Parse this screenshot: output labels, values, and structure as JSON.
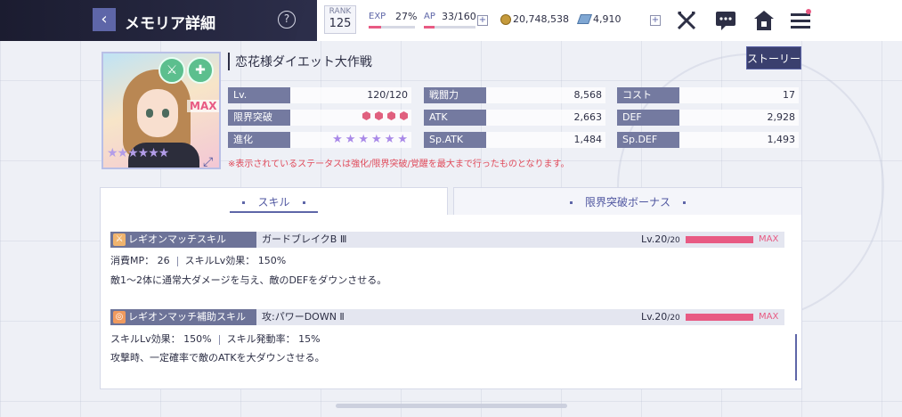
{
  "header": {
    "title": "メモリア詳細",
    "help": "?",
    "rank_label": "RANK",
    "rank_value": "125",
    "exp_label": "EXP",
    "exp_value": "27%",
    "exp_progress": 0.27,
    "ap_label": "AP",
    "ap_value": "33/160",
    "ap_progress": 0.21,
    "plus": "+",
    "gold": "20,748,538",
    "crystal": "4,910",
    "icons": [
      "back-icon",
      "help-icon",
      "battle-icon",
      "chat-icon",
      "home-icon",
      "menu-icon"
    ]
  },
  "card": {
    "name": "恋花様ダイエット大作戦",
    "max_tag": "MAX",
    "stars": "★★★★★★",
    "story_button": "ストーリー",
    "stats_left": [
      {
        "label": "Lv.",
        "value": "120/120"
      },
      {
        "label": "限界突破",
        "value": "gems",
        "gem_count": 4
      },
      {
        "label": "進化",
        "value": "stars",
        "star_count": 6
      }
    ],
    "stats_mid": [
      {
        "label": "戦闘力",
        "value": "8,568"
      },
      {
        "label": "ATK",
        "value": "2,663"
      },
      {
        "label": "Sp.ATK",
        "value": "1,484"
      }
    ],
    "stats_right": [
      {
        "label": "コスト",
        "value": "17"
      },
      {
        "label": "DEF",
        "value": "2,928"
      },
      {
        "label": "Sp.DEF",
        "value": "1,493"
      }
    ],
    "note": "※表示されているステータスは強化/限界突破/覚醒を最大まで行ったものとなります。"
  },
  "tabs": [
    {
      "label": "スキル",
      "active": true
    },
    {
      "label": "限界突破ボーナス",
      "active": false
    }
  ],
  "skills": [
    {
      "type": "レギオンマッチスキル",
      "name": "ガードブレイクB Ⅲ",
      "lv": "Lv.20",
      "lv_max": "/20",
      "max": "MAX",
      "detail_a_label": "消費MP：",
      "detail_a_value": "26",
      "detail_b_label": "スキルLv効果：",
      "detail_b_value": "150%",
      "desc": "敵1～2体に通常大ダメージを与え、敵のDEFをダウンさせる。"
    },
    {
      "type": "レギオンマッチ補助スキル",
      "name": "攻:パワーDOWN Ⅱ",
      "lv": "Lv.20",
      "lv_max": "/20",
      "max": "MAX",
      "detail_a_label": "スキルLv効果：",
      "detail_a_value": "150%",
      "detail_b_label": "スキル発動率：",
      "detail_b_value": "15%",
      "desc": "攻撃時、一定確率で敵のATKを大ダウンさせる。"
    }
  ],
  "colors": {
    "header_dark": "#1e2036",
    "accent": "#5e66a8",
    "pink": "#e85a83",
    "note_red": "#e04a5a"
  }
}
